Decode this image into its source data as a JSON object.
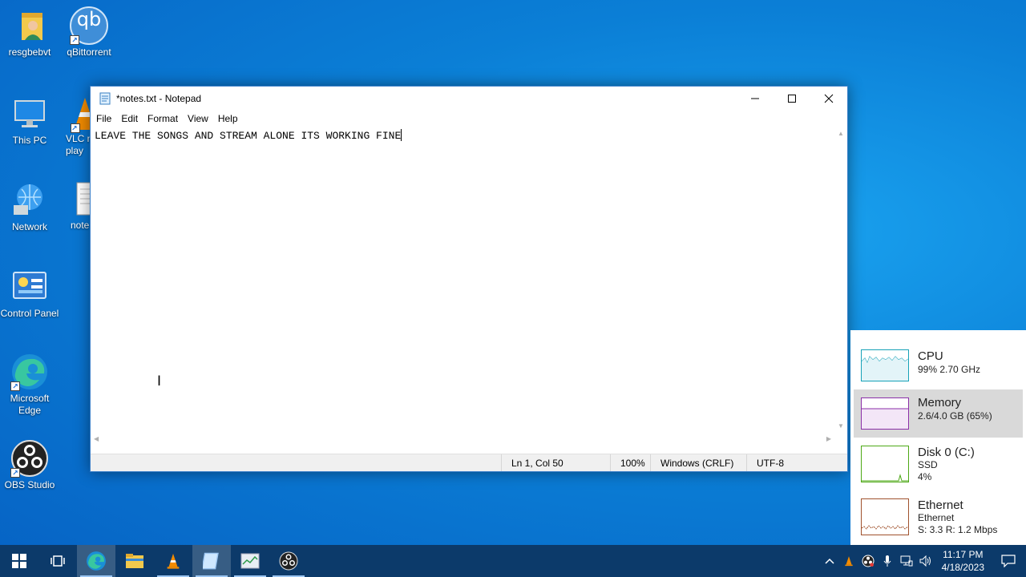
{
  "desktop": {
    "icons": [
      {
        "label": "resgbebvt",
        "icon": "user-folder-icon"
      },
      {
        "label": "qBittorrent",
        "icon": "qbittorrent-icon",
        "glyph": "qb"
      },
      {
        "label": "This PC",
        "icon": "this-pc-icon"
      },
      {
        "label": "VLC m\nplay",
        "icon": "vlc-icon"
      },
      {
        "label": "Network",
        "icon": "network-icon"
      },
      {
        "label": "note",
        "icon": "text-file-icon"
      },
      {
        "label": "Control Panel",
        "icon": "control-panel-icon"
      },
      {
        "label": "Microsoft Edge",
        "icon": "edge-icon"
      },
      {
        "label": "OBS Studio",
        "icon": "obs-icon"
      }
    ]
  },
  "notepad": {
    "title": "*notes.txt - Notepad",
    "menu": [
      "File",
      "Edit",
      "Format",
      "View",
      "Help"
    ],
    "content": "LEAVE THE SONGS AND STREAM ALONE ITS WORKING FINE",
    "status": {
      "position": "Ln 1, Col 50",
      "zoom": "100%",
      "line_endings": "Windows (CRLF)",
      "encoding": "UTF-8"
    }
  },
  "performance": {
    "cpu": {
      "name": "CPU",
      "detail": "99%  2.70 GHz",
      "color": "#17a2b8"
    },
    "memory": {
      "name": "Memory",
      "detail": "2.6/4.0 GB (65%)",
      "color": "#8b2fa8"
    },
    "disk": {
      "name": "Disk 0 (C:)",
      "type": "SSD",
      "detail": "4%",
      "color": "#4da816"
    },
    "ethernet": {
      "name": "Ethernet",
      "adapter": "Ethernet",
      "detail": "S: 3.3  R: 1.2 Mbps",
      "color": "#a0522d"
    }
  },
  "taskbar": {
    "apps": [
      "start-icon",
      "task-view-icon",
      "edge-icon",
      "file-explorer-icon",
      "vlc-icon",
      "notepad-icon",
      "task-manager-icon",
      "obs-icon"
    ],
    "clock": {
      "time": "11:17 PM",
      "date": "4/18/2023"
    }
  }
}
